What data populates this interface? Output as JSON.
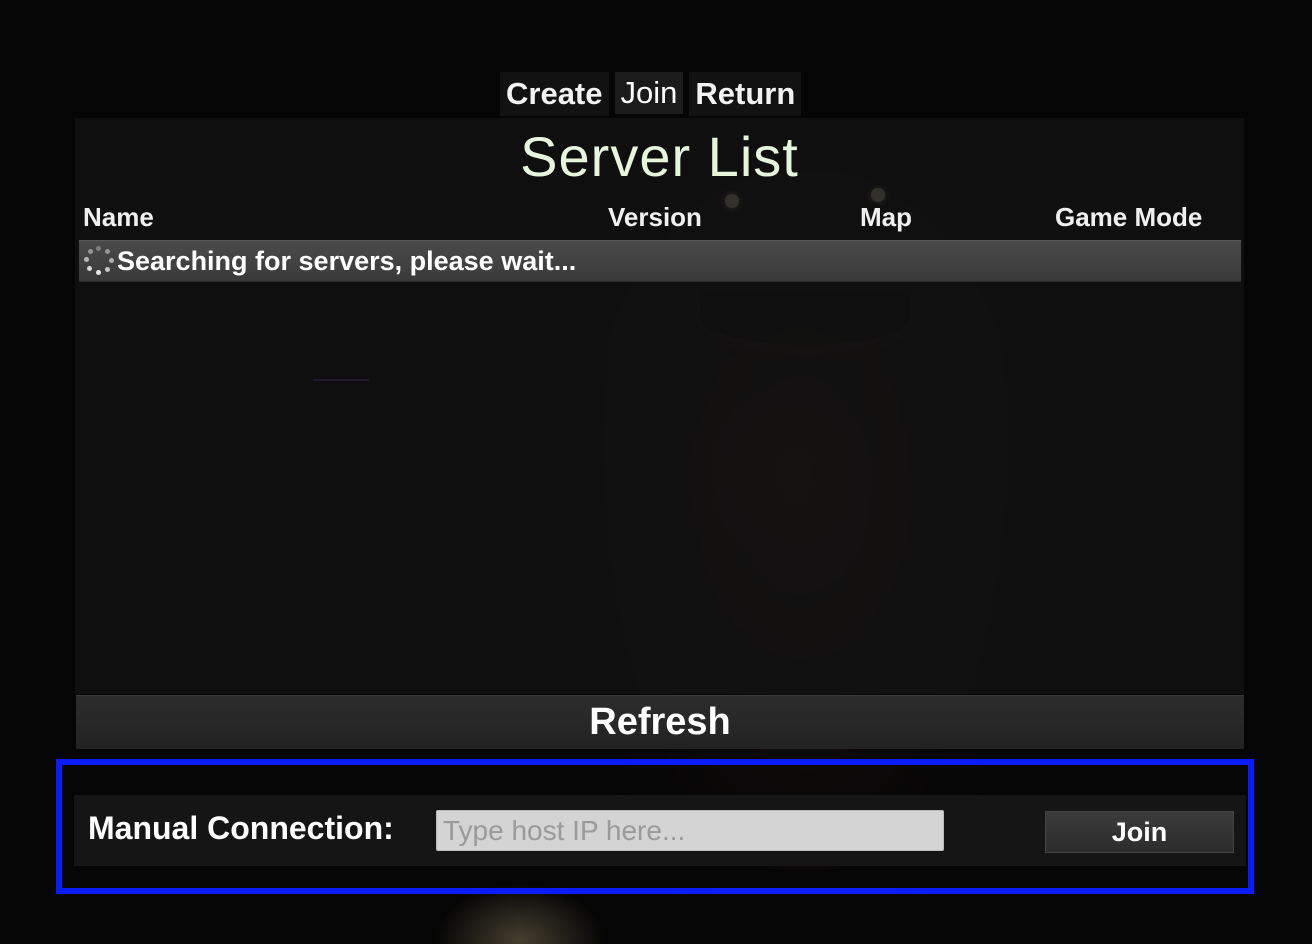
{
  "tabs": {
    "create": "Create",
    "join": "Join",
    "return": "Return",
    "active": "join"
  },
  "server_list": {
    "title": "Server List",
    "columns": {
      "name": "Name",
      "version": "Version",
      "map": "Map",
      "game_mode": "Game Mode"
    },
    "status_row": "Searching for servers, please wait...",
    "rows": []
  },
  "refresh_label": "Refresh",
  "manual_connection": {
    "label": "Manual Connection:",
    "input_value": "",
    "input_placeholder": "Type host IP here...",
    "join_label": "Join"
  },
  "icons": {
    "status_spinner": "loading-spinner-icon"
  },
  "colors": {
    "title": "#e6f5dc",
    "highlight_frame": "#0a1cf7",
    "row_highlight": "#444444"
  }
}
